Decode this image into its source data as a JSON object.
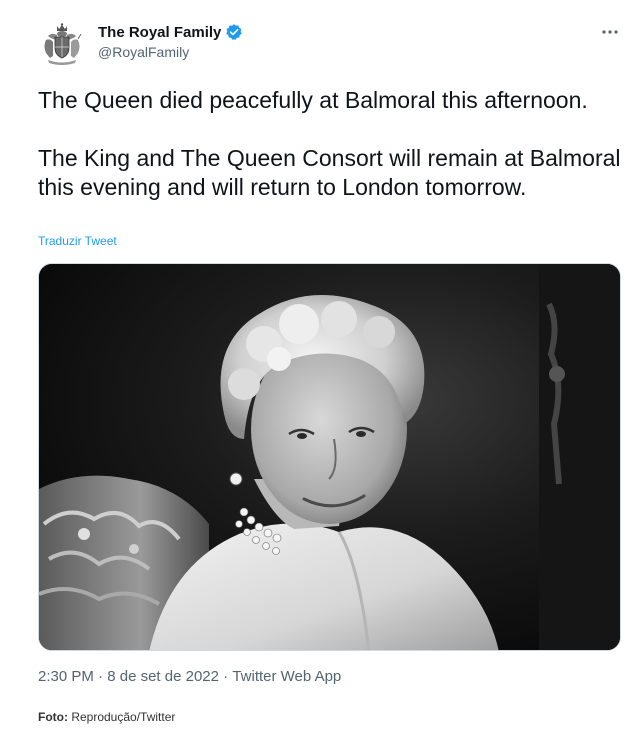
{
  "author": {
    "display_name": "The Royal Family",
    "handle": "@RoyalFamily",
    "verified": true,
    "avatar_icon": "royal-coat-of-arms-icon"
  },
  "menu": {
    "more_icon": "more-options-icon"
  },
  "tweet": {
    "paragraph_1": "The Queen died peacefully at Balmoral this afternoon.",
    "paragraph_2": "The King and The Queen Consort will remain at Balmoral this evening and will return to London tomorrow.",
    "translate_label": "Traduzir Tweet"
  },
  "media": {
    "type": "photo",
    "style": "black-and-white portrait"
  },
  "meta": {
    "time": "2:30 PM",
    "separator": " · ",
    "date": "8 de set de 2022",
    "source": "Twitter Web App"
  },
  "credit": {
    "label": "Foto:",
    "text": " Reprodução/Twitter"
  },
  "colors": {
    "text": "#0f1419",
    "secondary": "#536471",
    "link": "#1d9bf0",
    "verified": "#1d9bf0"
  }
}
